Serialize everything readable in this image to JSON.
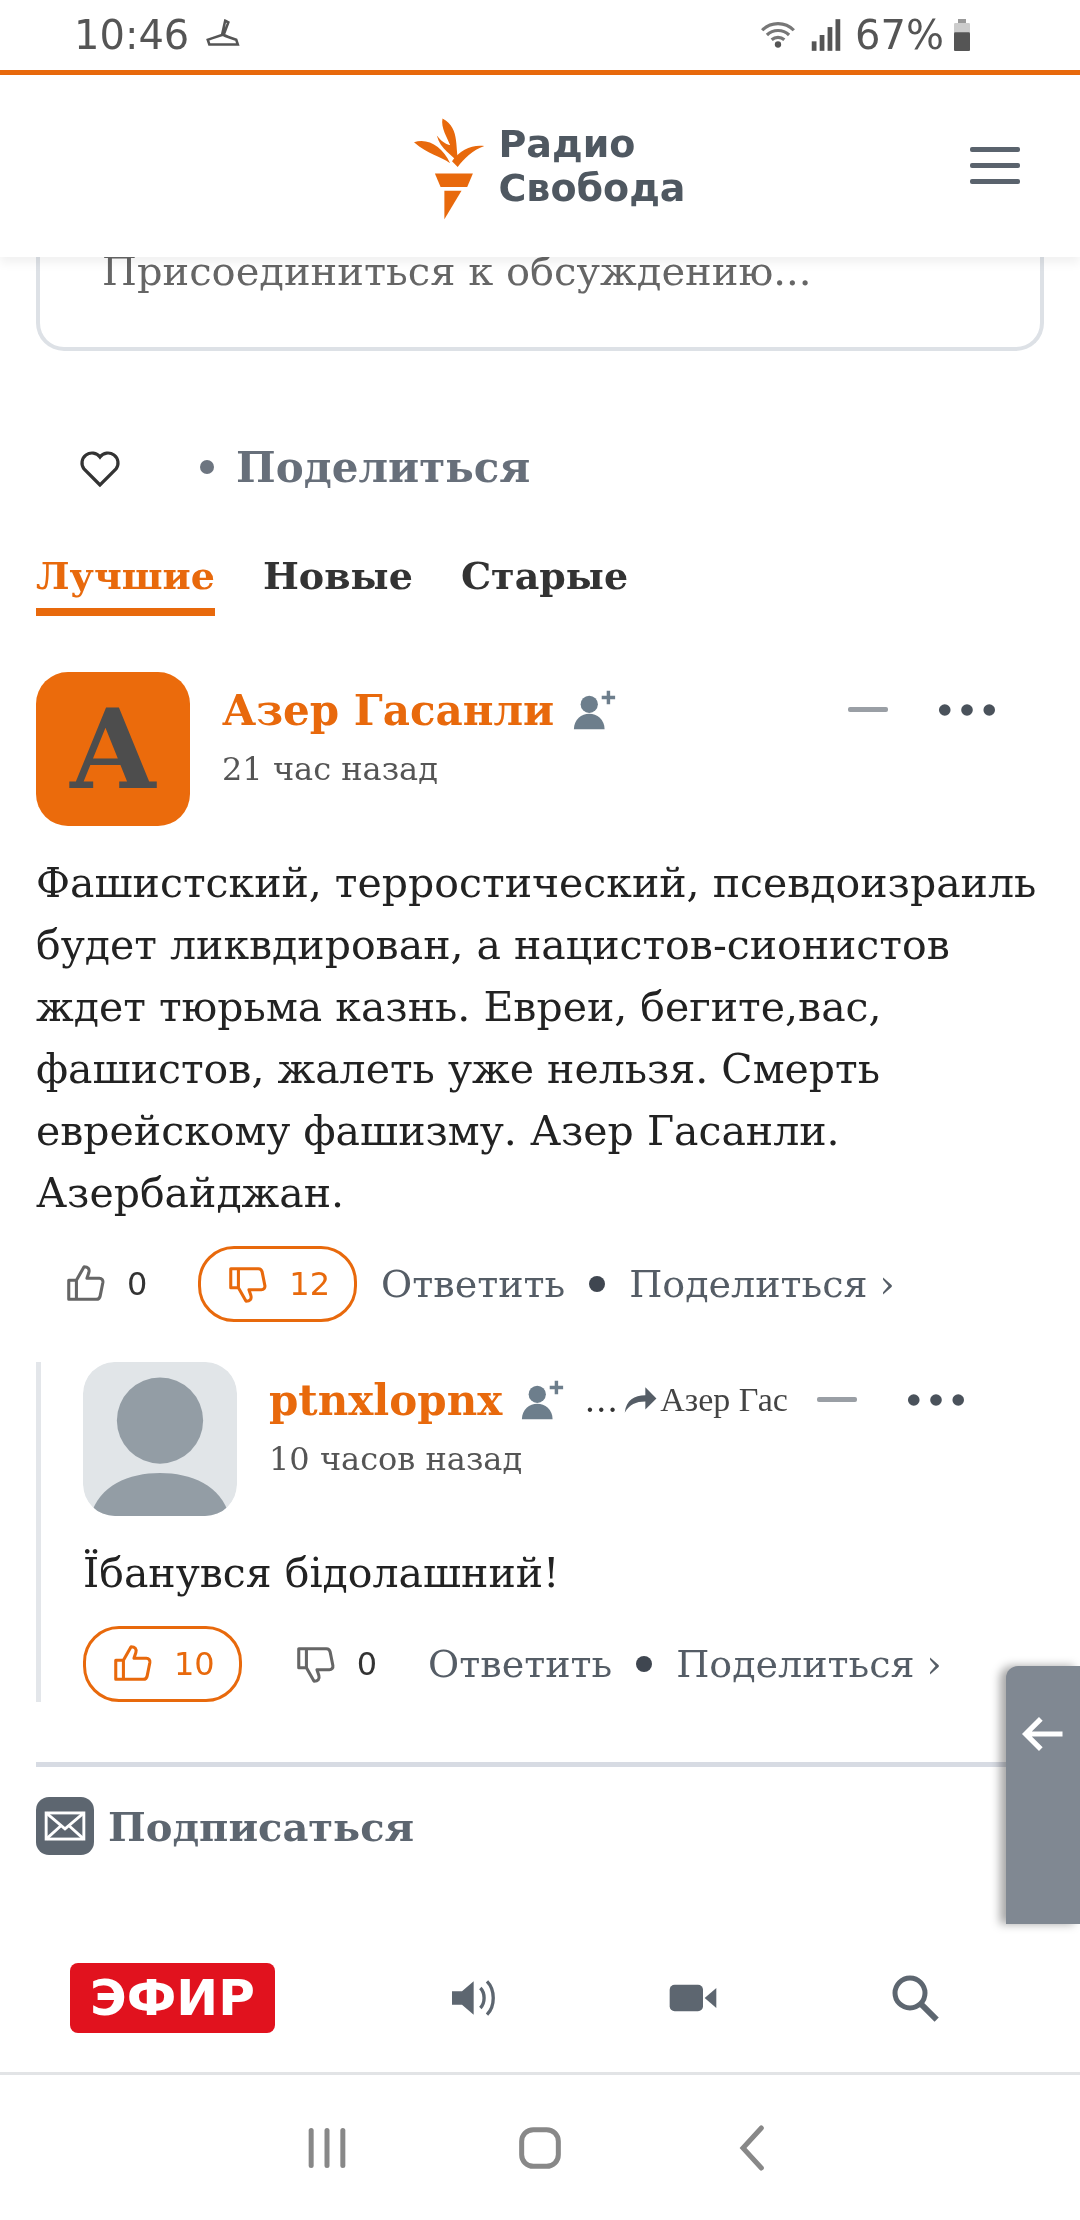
{
  "status_bar": {
    "time": "10:46",
    "battery": "67%"
  },
  "header": {
    "logo_line_1": "Радио",
    "logo_line_2": "Свобода"
  },
  "comment_input": {
    "placeholder": "Присоединиться к обсуждению..."
  },
  "article_actions": {
    "liked": false,
    "share": "Поделиться"
  },
  "sort_tabs": [
    {
      "label": "Лучшие",
      "selected": true
    },
    {
      "label": "Новые",
      "selected": false
    },
    {
      "label": "Старые",
      "selected": false
    }
  ],
  "comments": [
    {
      "avatar": {
        "kind": "letter",
        "letter": "А"
      },
      "author": "Азер Гасанли",
      "time": "21 час назад",
      "text": "Фашистский, терростический, псевдоизраиль будет ликвдирован, а нацистов-сионистов ждет тюрьма казнь. Евреи, бегите,вас, фашистов, жалеть уже нельзя. Смерть еврейскому фашизму. Азер Гасанли. Азербайджан.",
      "likes": "0",
      "liked": false,
      "dislikes": "12",
      "disliked": true,
      "reply": "Ответить",
      "share": "Поделиться ›",
      "children": [
        {
          "avatar": {
            "kind": "placeholder"
          },
          "author": "ptnxlopnx",
          "reply_to_ellipsis": "…",
          "reply_to": "Азер Гас",
          "time": "10 часов назад",
          "text": "Їбанувся бідолашний!",
          "likes": "10",
          "liked": true,
          "dislikes": "0",
          "disliked": false,
          "reply": "Ответить",
          "share": "Поделиться ›"
        }
      ]
    }
  ],
  "subscribe": "Подписаться",
  "bottom_nav": {
    "live": "ЭФИР"
  }
}
